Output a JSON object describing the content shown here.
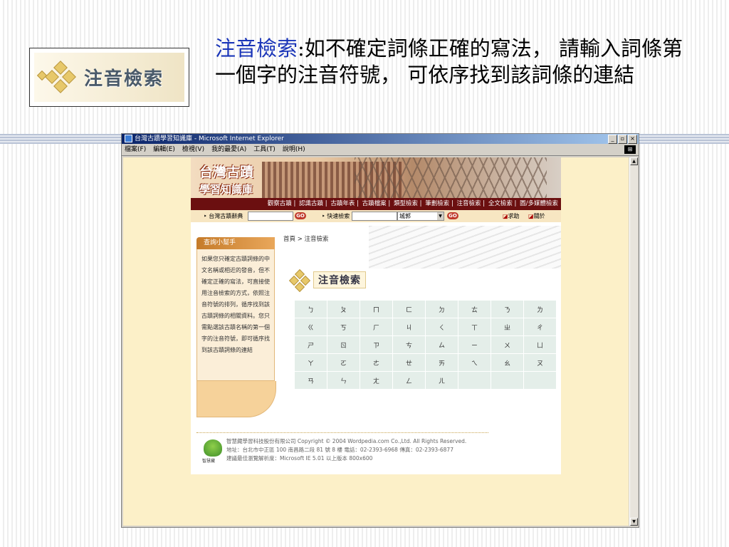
{
  "slide": {
    "logo_text": "注音檢索",
    "heading_highlight": "注音檢索",
    "heading_rest": ":如不確定詞條正確的寫法， 請輸入詞條第一個字的注音符號， 可依序找到該詞條的連結"
  },
  "window": {
    "title": "台灣古蹟學習知識庫 - Microsoft Internet Explorer",
    "buttons": [
      "_",
      "▫",
      "×"
    ],
    "menu": [
      "檔案(F)",
      "編輯(E)",
      "檢視(V)",
      "我的最愛(A)",
      "工具(T)",
      "說明(H)"
    ]
  },
  "site": {
    "title_line1": "台灣古蹟",
    "title_line2": "學習知識庫",
    "nav": [
      "觀察古蹟",
      "認識古蹟",
      "古蹟年表",
      "古蹟檔案",
      "類型檢索",
      "筆劃檢索",
      "注音檢索",
      "全文檢索",
      "圖/多媒體檢索"
    ],
    "search": {
      "dict_label": "‣ 台灣古蹟辭典",
      "go": "GO",
      "quick_label": "‣ 快速檢索",
      "select_value": "城郭",
      "help": "求助",
      "about": "關於"
    },
    "sidebar": {
      "title": "查詢小幫手",
      "body": "如果您只確定古蹟詞條的中文名稱或相近的發音，但不確定正確的寫法，可直接使用注音檢索的方式，依照注音符號的排列，循序找到該古蹟詞條的相關資料。您只需點選該古蹟名稱的第一個字的注音符號，即可循序找到該古蹟詞條的連結"
    },
    "breadcrumb": "首頁 > 注音檢索",
    "section_title": "注音檢索",
    "zhuyin_rows": [
      [
        "ㄅ",
        "ㄆ",
        "ㄇ",
        "ㄈ",
        "ㄉ",
        "ㄊ",
        "ㄋ",
        "ㄌ"
      ],
      [
        "ㄍ",
        "ㄎ",
        "ㄏ",
        "ㄐ",
        "ㄑ",
        "ㄒ",
        "ㄓ",
        "ㄔ"
      ],
      [
        "ㄕ",
        "ㄖ",
        "ㄗ",
        "ㄘ",
        "ㄙ",
        "ㄧ",
        "ㄨ",
        "ㄩ"
      ],
      [
        "ㄚ",
        "ㄛ",
        "ㄜ",
        "ㄝ",
        "ㄞ",
        "ㄟ",
        "ㄠ",
        "ㄡ"
      ],
      [
        "ㄢ",
        "ㄣ",
        "ㄤ",
        "ㄥ",
        "ㄦ",
        "",
        "",
        ""
      ]
    ],
    "footer": {
      "logo_label": "智慧藏",
      "line1": "智慧藏學習科技股份有限公司 Copyright © 2004 Wordpedia.com Co.,Ltd. All Rights Reserved.",
      "line2": "地址：台北市中正區 100 南昌路二段 81 號 8 樓 電話：02-2393-6968 傳真：02-2393-6877",
      "line3": "建議最佳瀏覽解析度：Microsoft IE 5.01 以上版本 800x600"
    }
  }
}
